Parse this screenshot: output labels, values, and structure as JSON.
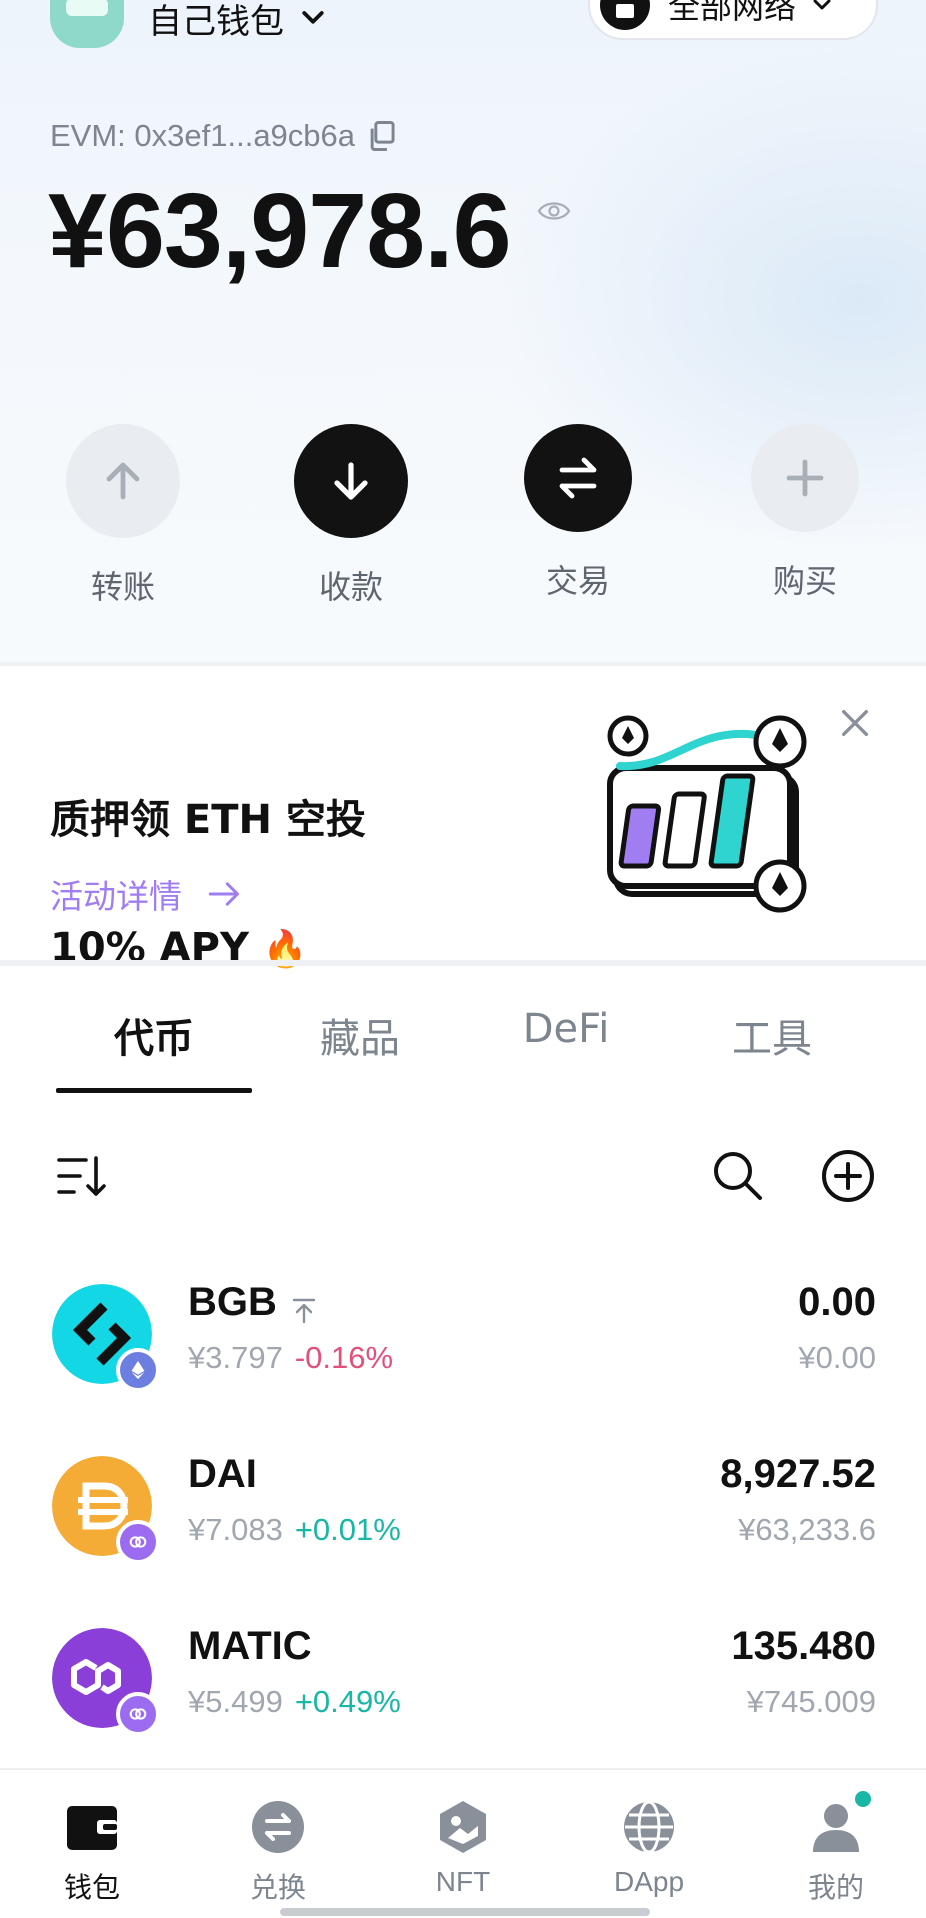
{
  "header": {
    "wallet_name": "自己钱包",
    "network_label": "全部网络",
    "address": "EVM: 0x3ef1...a9cb6a",
    "balance": "¥63,978.6"
  },
  "actions": [
    {
      "label": "转账",
      "icon": "arrow-up-icon"
    },
    {
      "label": "收款",
      "icon": "arrow-down-icon"
    },
    {
      "label": "交易",
      "icon": "swap-icon"
    },
    {
      "label": "购买",
      "icon": "plus-icon"
    }
  ],
  "banner": {
    "title_line1": "质押领 ETH 空投",
    "title_line2": "10% APY",
    "title_emoji": "🔥",
    "link_label": "活动详情"
  },
  "tabs": [
    "代币",
    "藏品",
    "DeFi",
    "工具"
  ],
  "active_tab": "代币",
  "tokens": [
    {
      "symbol": "BGB",
      "price": "¥3.797",
      "change": "-0.16%",
      "amount": "0.00",
      "value": "¥0.00",
      "pinned": true,
      "chain": "ethereum"
    },
    {
      "symbol": "DAI",
      "price": "¥7.083",
      "change": "+0.01%",
      "amount": "8,927.52",
      "value": "¥63,233.6",
      "pinned": false,
      "chain": "polygon"
    },
    {
      "symbol": "MATIC",
      "price": "¥5.499",
      "change": "+0.49%",
      "amount": "135.480",
      "value": "¥745.009",
      "pinned": false,
      "chain": "polygon"
    }
  ],
  "bottom_nav": [
    {
      "label": "钱包",
      "icon": "wallet-icon"
    },
    {
      "label": "兑换",
      "icon": "exchange-icon"
    },
    {
      "label": "NFT",
      "icon": "nft-icon"
    },
    {
      "label": "DApp",
      "icon": "globe-icon"
    },
    {
      "label": "我的",
      "icon": "profile-icon"
    }
  ],
  "colors": {
    "accent_purple": "#a17df2",
    "positive": "#18b7a6",
    "negative": "#e2507a",
    "bgb_logo": "#14d7e6",
    "dai_logo": "#f5ac37",
    "matic_logo": "#8247e5"
  }
}
